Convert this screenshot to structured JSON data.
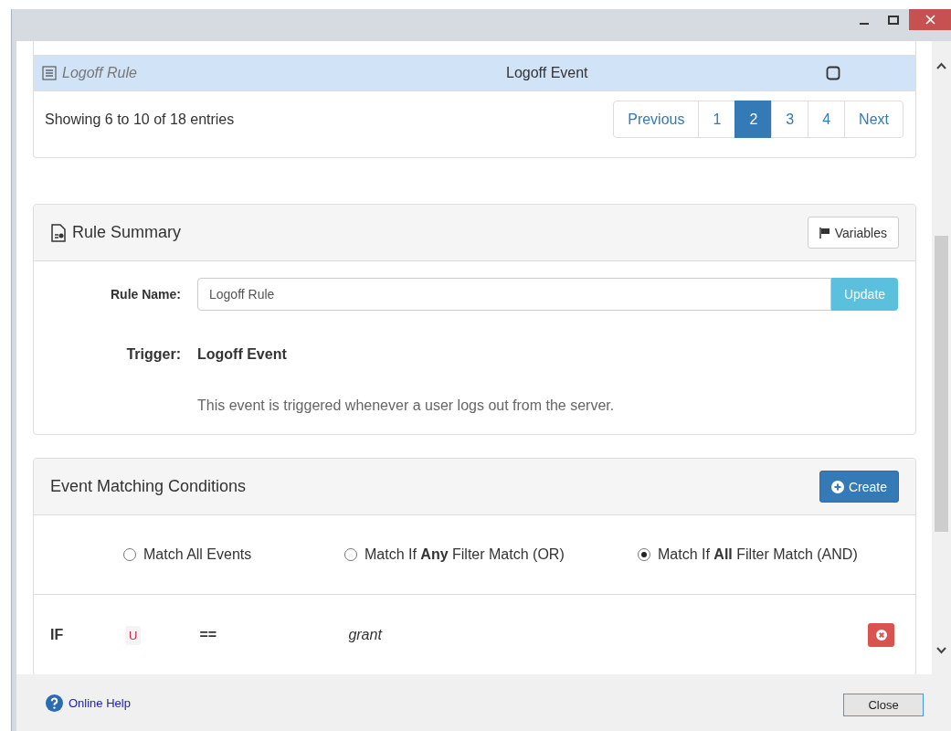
{
  "rules_table": {
    "rows": [
      {
        "name": "Logoff Rule",
        "event": "Logoff Event",
        "checked": false,
        "selected": true
      }
    ],
    "info": "Showing 6 to 10 of 18 entries",
    "pagination": [
      {
        "label": "Previous",
        "selected": false
      },
      {
        "label": "1",
        "selected": false
      },
      {
        "label": "2",
        "selected": true
      },
      {
        "label": "3",
        "selected": false
      },
      {
        "label": "4",
        "selected": false
      },
      {
        "label": "Next",
        "selected": false
      }
    ]
  },
  "rule_summary": {
    "title": "Rule Summary",
    "variables_button": "Variables",
    "name_label": "Rule Name:",
    "name_value": "Logoff Rule",
    "update_button": "Update",
    "trigger_label": "Trigger:",
    "trigger_value": "Logoff Event",
    "trigger_description": "This event is triggered whenever a user logs out from the server."
  },
  "conditions": {
    "title": "Event Matching Conditions",
    "create_button": "Create",
    "match_options": [
      {
        "label": "Match All Events",
        "selected": false
      },
      {
        "label": "Match If **Any** Filter Match (OR)",
        "selected": false
      },
      {
        "label": "Match If **All** Filter Match (AND)",
        "selected": true
      }
    ],
    "filters": [
      {
        "keyword": "IF",
        "field": "U",
        "operator": "==",
        "value": "grant"
      }
    ]
  },
  "footer": {
    "help_link": "Online Help",
    "close_button": "Close"
  }
}
